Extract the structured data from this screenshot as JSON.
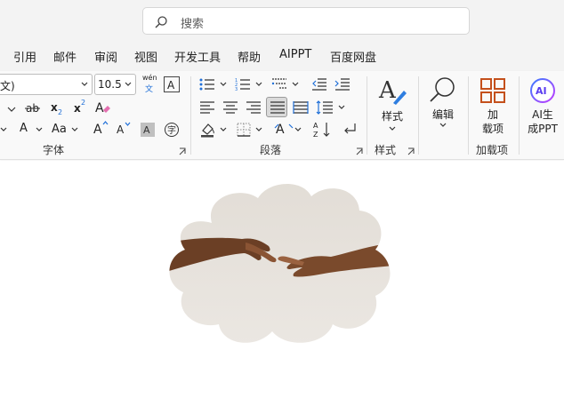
{
  "search": {
    "placeholder": "搜索",
    "icon": "search-icon"
  },
  "menu": [
    "引用",
    "邮件",
    "审阅",
    "视图",
    "开发工具",
    "帮助",
    "AIPPT",
    "百度网盘"
  ],
  "font": {
    "name_value": "文)",
    "size_value": "10.5",
    "phonetic_top": "wén",
    "phonetic_bottom": "文",
    "aa_label": "Aa",
    "group_label": "字体"
  },
  "paragraph": {
    "group_label": "段落"
  },
  "styles": {
    "label": "样式",
    "group_label": "样式"
  },
  "editing": {
    "label": "编辑"
  },
  "addins": {
    "label_line1": "加",
    "label_line2": "载项",
    "group_label": "加载项"
  },
  "aippt": {
    "badge": "AI",
    "label_line1": "AI生",
    "label_line2": "成PPT"
  },
  "colors": {
    "ribbon_bg": "#f9f9f9",
    "top_bg": "#f3f3f3",
    "addins_accent": "#c4501c",
    "ai_gradient_start": "#3a7bff",
    "ai_gradient_end": "#c23cff",
    "highlight_btn": "#dadada"
  },
  "document": {
    "image": "cloud-shaped photo of two hands reaching toward each other"
  }
}
